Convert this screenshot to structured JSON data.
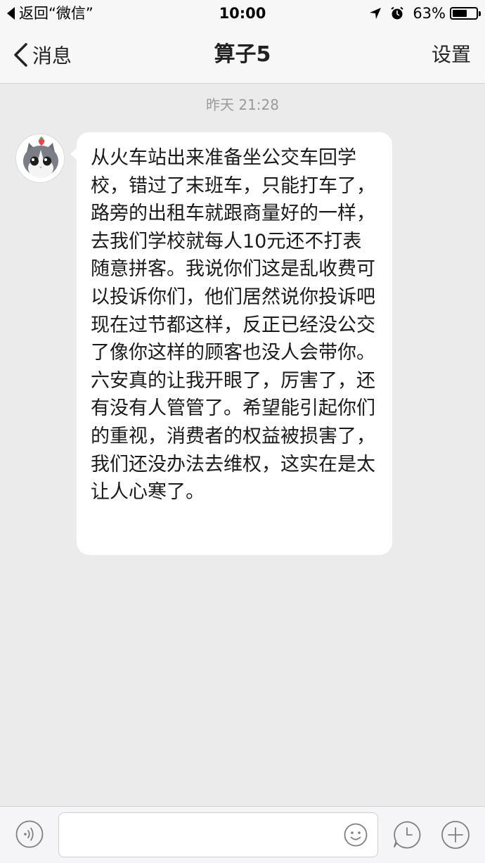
{
  "status_bar": {
    "back_label": "返回“微信”",
    "time": "10:00",
    "battery_percent": "63%",
    "battery_level": 0.63,
    "icons": [
      "location-arrow-icon",
      "alarm-clock-icon",
      "battery-icon"
    ]
  },
  "nav": {
    "back_label": "消息",
    "title": "算子5",
    "settings_label": "设置"
  },
  "chat": {
    "timestamp": "昨天 21:28",
    "messages": [
      {
        "sender": "other",
        "avatar": "cat-avatar",
        "text": "从火车站出来准备坐公交车回学校，错过了末班车，只能打车了，路旁的出租车就跟商量好的一样，去我们学校就每人10元还不打表随意拼客。我说你们这是乱收费可以投诉你们，他们居然说你投诉吧现在过节都这样，反正已经没公交了像你这样的顾客也没人会带你。六安真的让我开眼了，厉害了，还有没有人管管了。希望能引起你们的重视，消费者的权益被损害了，我们还没办法去维权，这实在是太让人心寒了。"
      }
    ]
  },
  "input_bar": {
    "icons": [
      "voice-icon",
      "emoji-icon",
      "clock-icon",
      "plus-icon"
    ],
    "text_value": ""
  }
}
